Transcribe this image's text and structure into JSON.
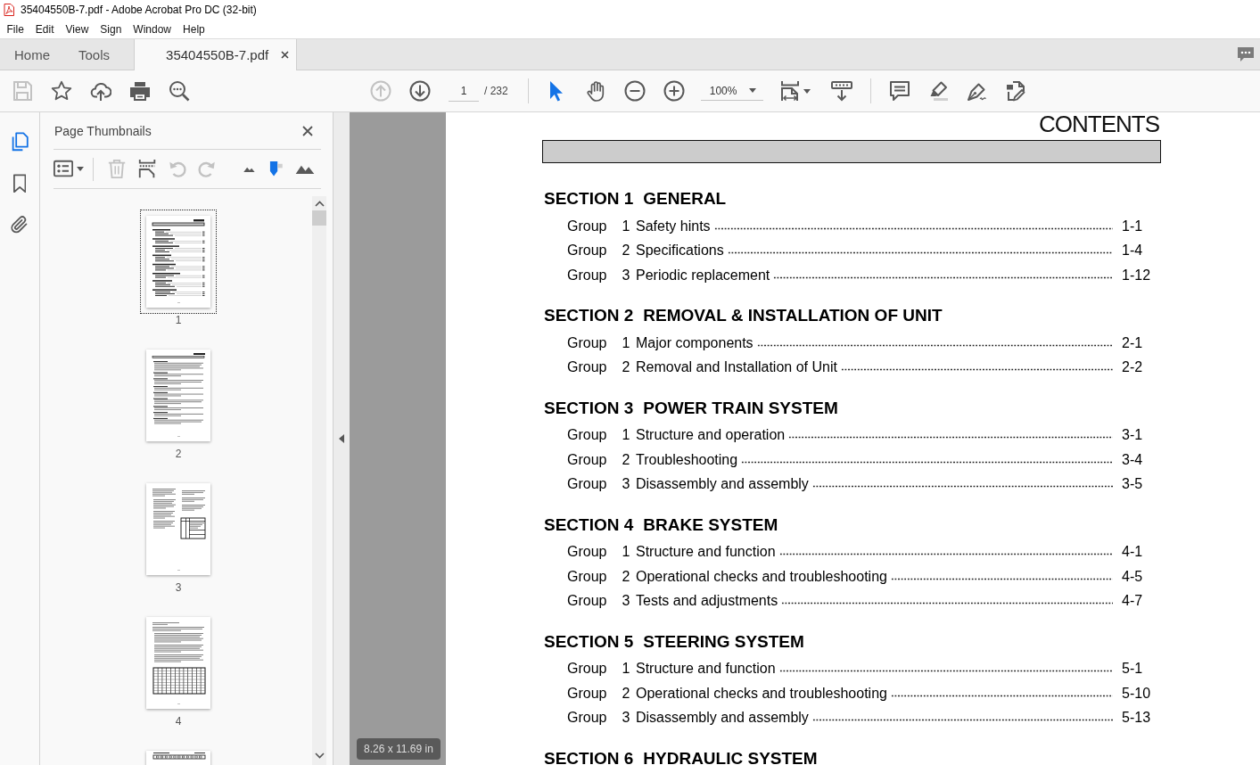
{
  "window": {
    "title": "35404550B-7.pdf - Adobe Acrobat Pro DC (32-bit)"
  },
  "menu_bar": [
    "File",
    "Edit",
    "View",
    "Sign",
    "Window",
    "Help"
  ],
  "tabs": [
    {
      "label": "Home",
      "selected": false,
      "closable": false
    },
    {
      "label": "Tools",
      "selected": false,
      "closable": false
    },
    {
      "label": "35404550B-7.pdf",
      "selected": true,
      "closable": true
    }
  ],
  "toolbar": {
    "file_tools": [
      {
        "kind": "save",
        "disabled": true
      },
      {
        "kind": "star",
        "disabled": false
      },
      {
        "kind": "upload",
        "disabled": false
      },
      {
        "kind": "print",
        "disabled": false
      },
      {
        "kind": "search",
        "disabled": false
      }
    ],
    "page_nav": [
      {
        "kind": "up",
        "disabled": true
      },
      {
        "kind": "down",
        "disabled": false
      }
    ],
    "page_field": {
      "value": "1"
    },
    "page_count": "/ 232",
    "select_tools": [
      {
        "kind": "pointer",
        "selected": true
      },
      {
        "kind": "hand",
        "selected": false
      }
    ],
    "zoom_tools": [
      {
        "kind": "minus",
        "disabled": false
      },
      {
        "kind": "plus",
        "disabled": false
      }
    ],
    "zoom_field": {
      "value": "100%"
    },
    "view_tools": [
      {
        "kind": "fit",
        "disabled": false
      },
      {
        "kind": "scroll",
        "disabled": false
      }
    ],
    "annotate_tools": [
      {
        "kind": "comment",
        "disabled": false
      },
      {
        "kind": "highlight",
        "disabled": false
      },
      {
        "kind": "sign",
        "disabled": false
      },
      {
        "kind": "edit",
        "disabled": false
      }
    ]
  },
  "rail": [
    {
      "kind": "pages",
      "selected": true
    },
    {
      "kind": "bookmarks",
      "selected": false
    },
    {
      "kind": "attachments",
      "selected": false
    }
  ],
  "thumbnail_panel": {
    "title": "Page Thumbnails",
    "tools": [
      {
        "kind": "options",
        "disabled": false
      },
      {
        "kind": "delete",
        "disabled": true
      },
      {
        "kind": "insert",
        "disabled": false
      },
      {
        "kind": "rotateleft",
        "disabled": true
      },
      {
        "kind": "rotateright",
        "disabled": true
      },
      {
        "kind": "shrink",
        "disabled": false
      },
      {
        "kind": "size",
        "disabled": false
      },
      {
        "kind": "enlarge",
        "disabled": false
      }
    ],
    "thumbnails": [
      {
        "kind": "contents",
        "label": "1",
        "selected": true
      },
      {
        "kind": "text",
        "label": "2",
        "selected": false
      },
      {
        "kind": "table",
        "label": "3",
        "selected": false
      },
      {
        "kind": "grid",
        "label": "4",
        "selected": false
      },
      {
        "kind": "boxes",
        "selected": false
      }
    ]
  },
  "page_size_label": "8.26 x 11.69 in",
  "document": {
    "heading": "CONTENTS",
    "sections": [
      {
        "number": "SECTION 1",
        "title": "GENERAL",
        "groups": [
          {
            "label": "Group",
            "number": "1",
            "title": "Safety hints",
            "page": "1-1"
          },
          {
            "label": "Group",
            "number": "2",
            "title": "Specifications",
            "page": "1-4"
          },
          {
            "label": "Group",
            "number": "3",
            "title": "Periodic replacement",
            "page": "1-12"
          }
        ]
      },
      {
        "number": "SECTION 2",
        "title": "REMOVAL & INSTALLATION OF UNIT",
        "groups": [
          {
            "label": "Group",
            "number": "1",
            "title": "Major components",
            "page": "2-1"
          },
          {
            "label": "Group",
            "number": "2",
            "title": "Removal and Installation of Unit",
            "page": "2-2"
          }
        ]
      },
      {
        "number": "SECTION 3",
        "title": "POWER TRAIN SYSTEM",
        "groups": [
          {
            "label": "Group",
            "number": "1",
            "title": "Structure and operation",
            "page": "3-1"
          },
          {
            "label": "Group",
            "number": "2",
            "title": "Troubleshooting",
            "page": "3-4"
          },
          {
            "label": "Group",
            "number": "3",
            "title": "Disassembly and assembly",
            "page": "3-5"
          }
        ]
      },
      {
        "number": "SECTION 4",
        "title": "BRAKE SYSTEM",
        "groups": [
          {
            "label": "Group",
            "number": "1",
            "title": "Structure and function",
            "page": "4-1"
          },
          {
            "label": "Group",
            "number": "2",
            "title": "Operational checks and troubleshooting",
            "page": "4-5"
          },
          {
            "label": "Group",
            "number": "3",
            "title": "Tests and adjustments",
            "page": "4-7"
          }
        ]
      },
      {
        "number": "SECTION 5",
        "title": "STEERING SYSTEM",
        "groups": [
          {
            "label": "Group",
            "number": "1",
            "title": "Structure and function",
            "page": "5-1"
          },
          {
            "label": "Group",
            "number": "2",
            "title": "Operational checks and troubleshooting",
            "page": "5-10"
          },
          {
            "label": "Group",
            "number": "3",
            "title": "Disassembly and assembly",
            "page": "5-13"
          }
        ]
      },
      {
        "number": "SECTION 6",
        "title": "HYDRAULIC SYSTEM"
      }
    ]
  }
}
